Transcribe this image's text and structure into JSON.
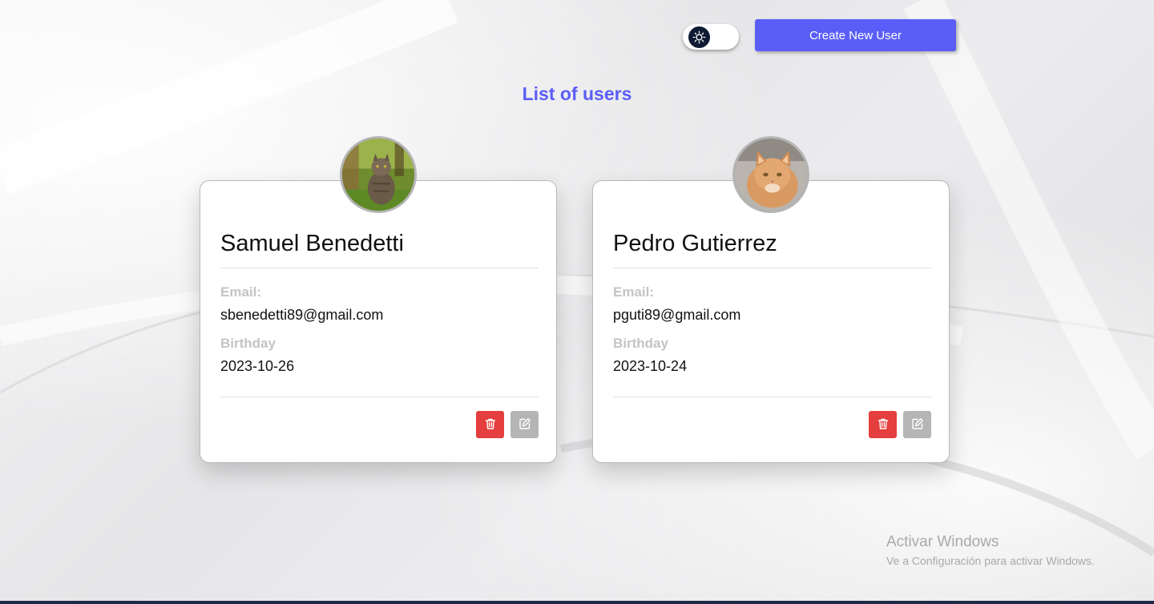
{
  "header": {
    "theme_toggle_icon": "sun-icon",
    "create_button_label": "Create New User"
  },
  "page": {
    "title": "List of users"
  },
  "users": [
    {
      "name": "Samuel Benedetti",
      "email_label": "Email:",
      "email": "sbenedetti89@gmail.com",
      "birthday_label": "Birthday",
      "birthday": "2023-10-26",
      "avatar": "tabby-cat-in-grass-photo"
    },
    {
      "name": "Pedro Gutierrez",
      "email_label": "Email:",
      "email": "pguti89@gmail.com",
      "birthday_label": "Birthday",
      "birthday": "2023-10-24",
      "avatar": "orange-cat-photo"
    }
  ],
  "actions": {
    "delete_icon": "trash-icon",
    "edit_icon": "pencil-icon"
  },
  "watermark": {
    "title": "Activar Windows",
    "subtitle": "Ve a Configuración para activar Windows."
  },
  "colors": {
    "accent": "#5a5ef7",
    "delete": "#e53e3e",
    "edit": "#b5b5b5",
    "toggle_knob": "#0f1b33"
  }
}
